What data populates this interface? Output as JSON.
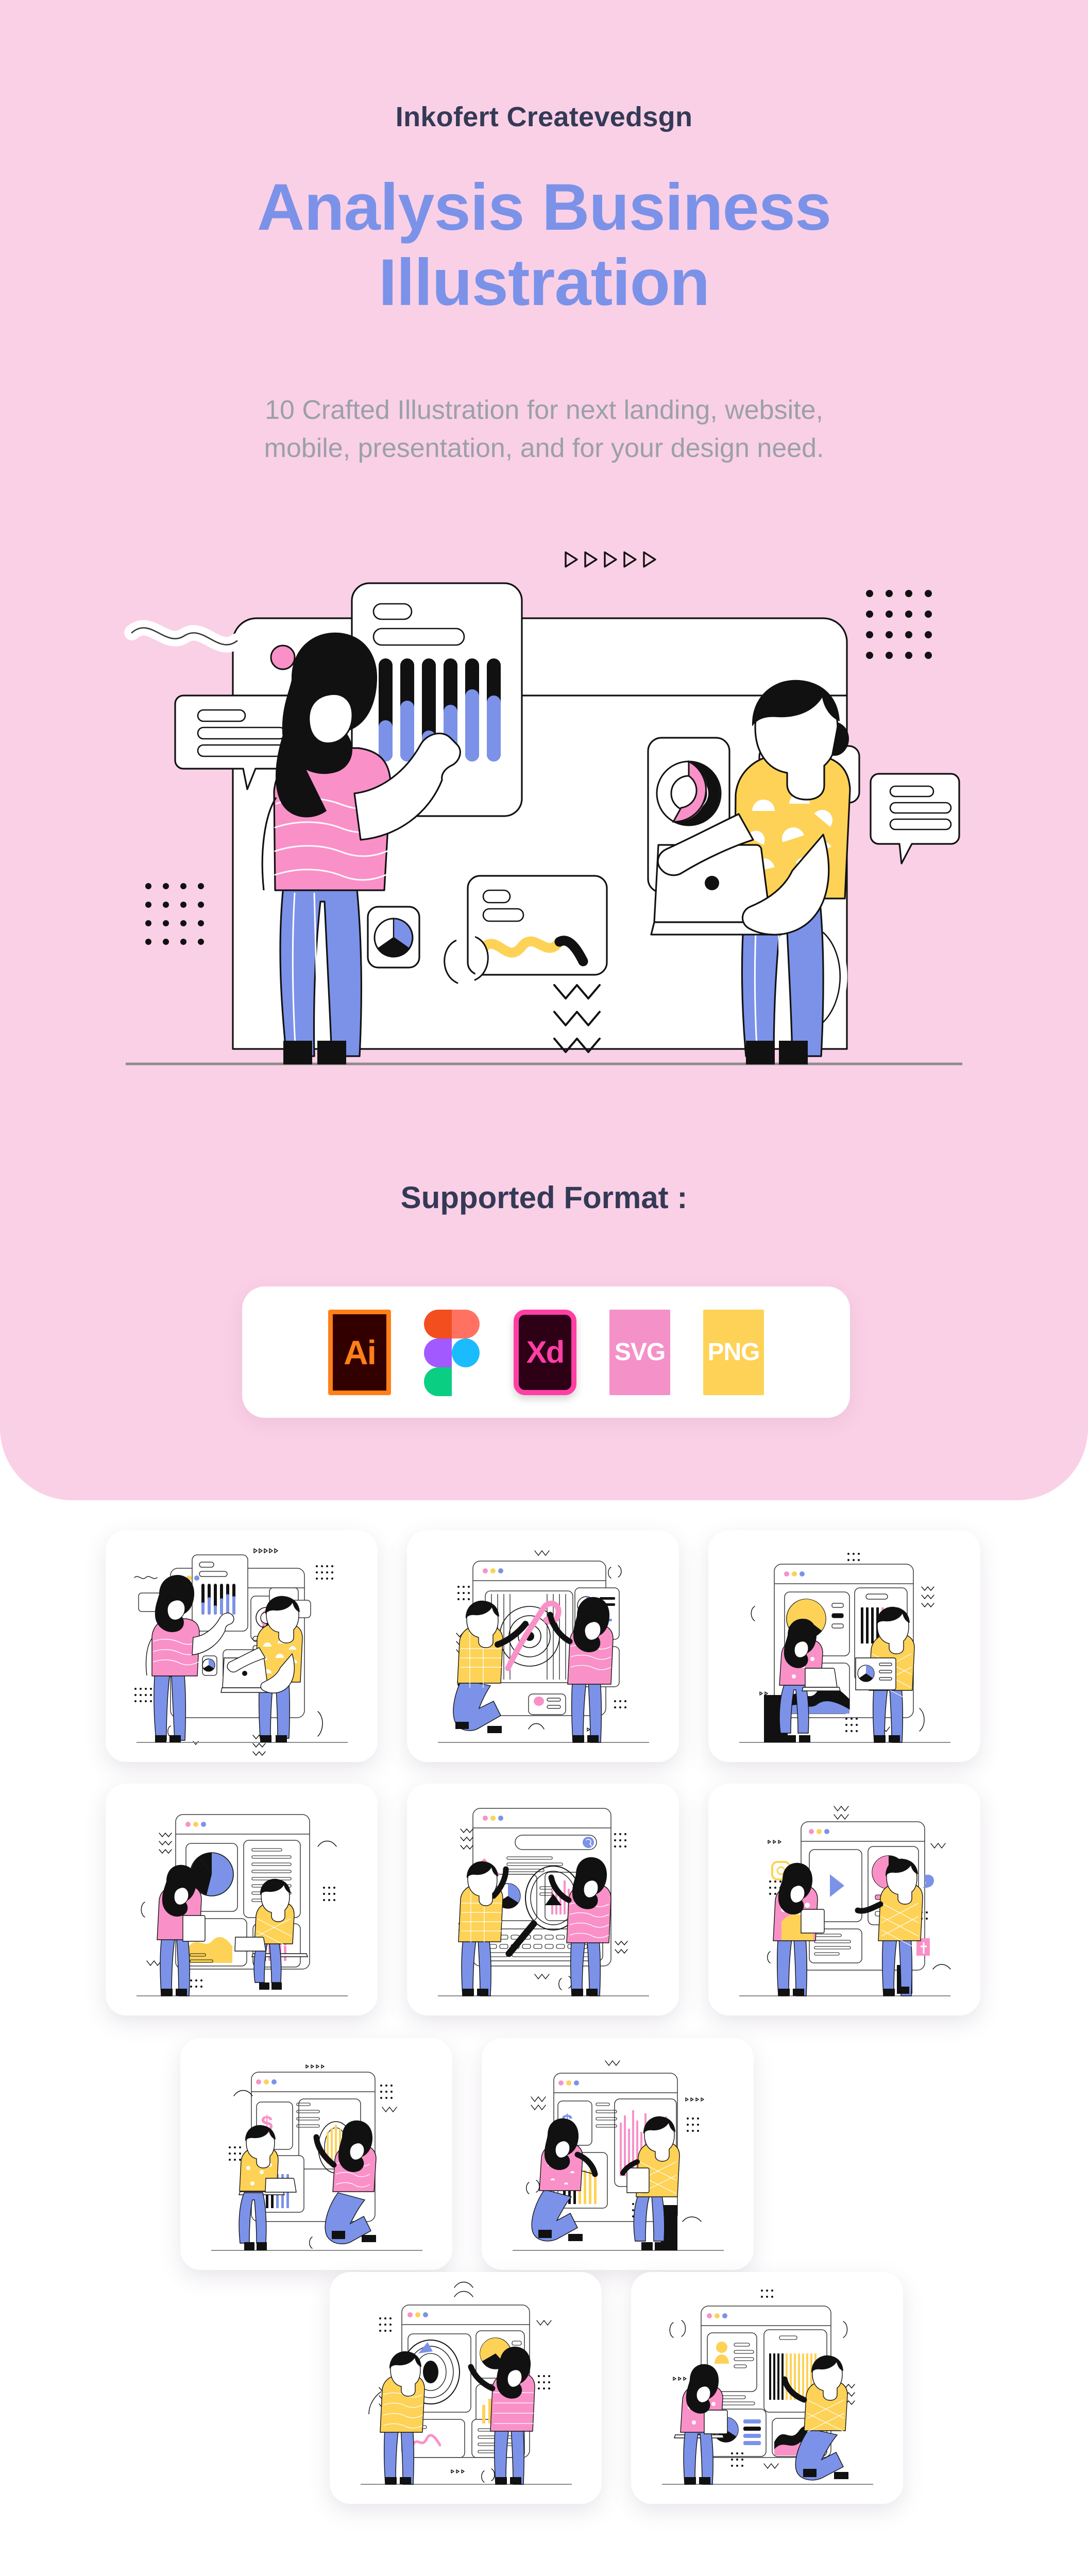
{
  "page": {
    "background": "#ffffff",
    "hero_background": "#fad0e6"
  },
  "hero": {
    "brand": "Inkofert Createvedsgn",
    "title_line1": "Analysis Business",
    "title_line2": "Illustration",
    "subtitle_line1": "10 Crafted Illustration for next landing, website,",
    "subtitle_line2": "mobile, presentation, and for your design need.",
    "title_color": "#7b92e8",
    "brand_color": "#333a56",
    "subtitle_color": "#9aa0ab",
    "illustration_name": "analysis-business-hero-illustration"
  },
  "formats": {
    "heading": "Supported Format :",
    "heading_color": "#333a56",
    "card_background": "#ffffff",
    "items": [
      {
        "id": "ai",
        "label": "Ai",
        "icon": "adobe-illustrator-icon",
        "bg": "#330000",
        "fg": "#ff7f18"
      },
      {
        "id": "figma",
        "label": "",
        "icon": "figma-icon",
        "bg": "#ffffff",
        "fg": "#f24e1e"
      },
      {
        "id": "xd",
        "label": "Xd",
        "icon": "adobe-xd-icon",
        "bg": "#2e0016",
        "fg": "#ff3fa4"
      },
      {
        "id": "svg",
        "label": "SVG",
        "icon": "svg-format-icon",
        "bg": "#f491c8",
        "fg": "#ffffff"
      },
      {
        "id": "png",
        "label": "PNG",
        "icon": "png-format-icon",
        "bg": "#fdd256",
        "fg": "#ffffff"
      }
    ]
  },
  "palette": {
    "pink_bg": "#fad0e6",
    "periwinkle": "#7b92e8",
    "shirt_pink": "#f991c8",
    "shirt_yellow": "#fdd256",
    "ink": "#000000",
    "navy": "#333a56",
    "grey_line": "#9aa0ab"
  },
  "thumbnails": {
    "count": 10,
    "items": [
      {
        "name": "thumb-1-dashboard-bar-duo",
        "row": 1,
        "col": 1
      },
      {
        "name": "thumb-2-target-analysis",
        "row": 1,
        "col": 2
      },
      {
        "name": "thumb-3-pie-report-duo",
        "row": 1,
        "col": 3
      },
      {
        "name": "thumb-4-pie-chart-desk",
        "row": 2,
        "col": 1
      },
      {
        "name": "thumb-5-settings-magnify",
        "row": 2,
        "col": 2
      },
      {
        "name": "thumb-6-social-media-panel",
        "row": 2,
        "col": 3
      },
      {
        "name": "thumb-7-finance-dollar-desk",
        "row": 3,
        "col": 1
      },
      {
        "name": "thumb-8-finance-dollar-bars",
        "row": 3,
        "col": 2
      },
      {
        "name": "thumb-9-magnifier-insight",
        "row": 4,
        "col": 1
      },
      {
        "name": "thumb-10-profile-analytics",
        "row": 4,
        "col": 2
      }
    ]
  }
}
